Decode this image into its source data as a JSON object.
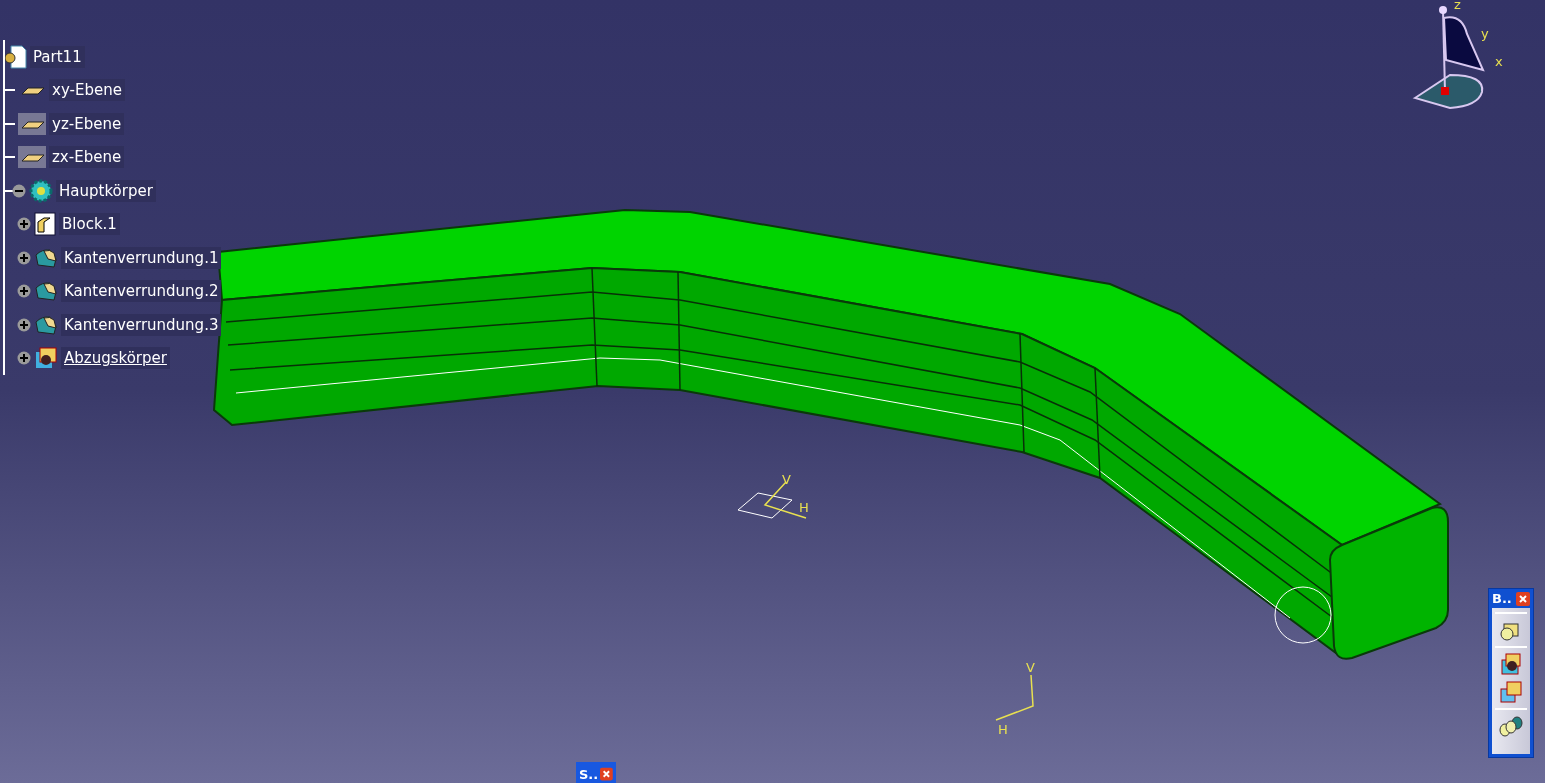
{
  "tree": {
    "label": "Part11",
    "kind": "part",
    "children": [
      {
        "label": "xy-Ebene",
        "kind": "plane",
        "hidden": false
      },
      {
        "label": "yz-Ebene",
        "kind": "plane",
        "hidden": true
      },
      {
        "label": "zx-Ebene",
        "kind": "plane",
        "hidden": true
      },
      {
        "label": "Hauptkörper",
        "kind": "body",
        "expanded": true,
        "children": [
          {
            "label": "Block.1",
            "kind": "pad",
            "expanded": false,
            "in_work": false
          },
          {
            "label": "Kantenverrundung.1",
            "kind": "fillet",
            "expanded": false,
            "in_work": false
          },
          {
            "label": "Kantenverrundung.2",
            "kind": "fillet",
            "expanded": false,
            "in_work": false
          },
          {
            "label": "Kantenverrundung.3",
            "kind": "fillet",
            "expanded": false,
            "in_work": false
          },
          {
            "label": "Abzugskörper",
            "kind": "remove",
            "expanded": false,
            "in_work": true
          }
        ]
      }
    ]
  },
  "compass": {
    "z": "z",
    "y": "y",
    "x": "x"
  },
  "sketch_axes": [
    {
      "v": "V",
      "h": "H"
    },
    {
      "v": "V",
      "h": "H"
    }
  ],
  "toolbar": {
    "title": "B..",
    "buttons": [
      {
        "kind": "pad"
      },
      {
        "kind": "pocket"
      },
      {
        "kind": "union"
      },
      {
        "kind": "spheres"
      }
    ]
  },
  "minimized_toolbar": {
    "title": "S.."
  }
}
